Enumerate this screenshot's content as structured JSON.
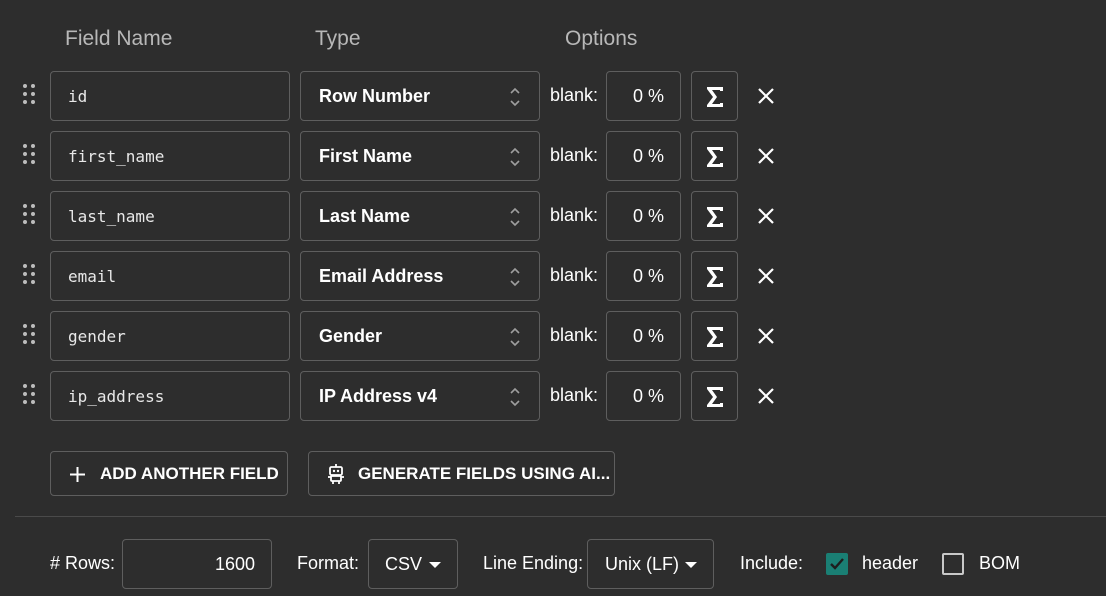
{
  "headers": {
    "field_name": "Field Name",
    "type": "Type",
    "options": "Options"
  },
  "fields": [
    {
      "name": "id",
      "type": "Row Number",
      "blank_label": "blank:",
      "blank_pct": "0 %"
    },
    {
      "name": "first_name",
      "type": "First Name",
      "blank_label": "blank:",
      "blank_pct": "0 %"
    },
    {
      "name": "last_name",
      "type": "Last Name",
      "blank_label": "blank:",
      "blank_pct": "0 %"
    },
    {
      "name": "email",
      "type": "Email Address",
      "blank_label": "blank:",
      "blank_pct": "0 %"
    },
    {
      "name": "gender",
      "type": "Gender",
      "blank_label": "blank:",
      "blank_pct": "0 %"
    },
    {
      "name": "ip_address",
      "type": "IP Address v4",
      "blank_label": "blank:",
      "blank_pct": "0 %"
    }
  ],
  "actions": {
    "add_field": "ADD ANOTHER FIELD",
    "generate_ai": "GENERATE FIELDS USING AI..."
  },
  "footer": {
    "rows_label": "# Rows:",
    "rows_value": "1600",
    "format_label": "Format:",
    "format_value": "CSV",
    "line_ending_label": "Line Ending:",
    "line_ending_value": "Unix (LF)",
    "include_label": "Include:",
    "header_label": "header",
    "header_checked": true,
    "bom_label": "BOM",
    "bom_checked": false
  },
  "colors": {
    "background": "#2d2d2d",
    "border": "#5e5e5e",
    "accent": "#1a7f74",
    "header_text": "#b8b8b8"
  }
}
